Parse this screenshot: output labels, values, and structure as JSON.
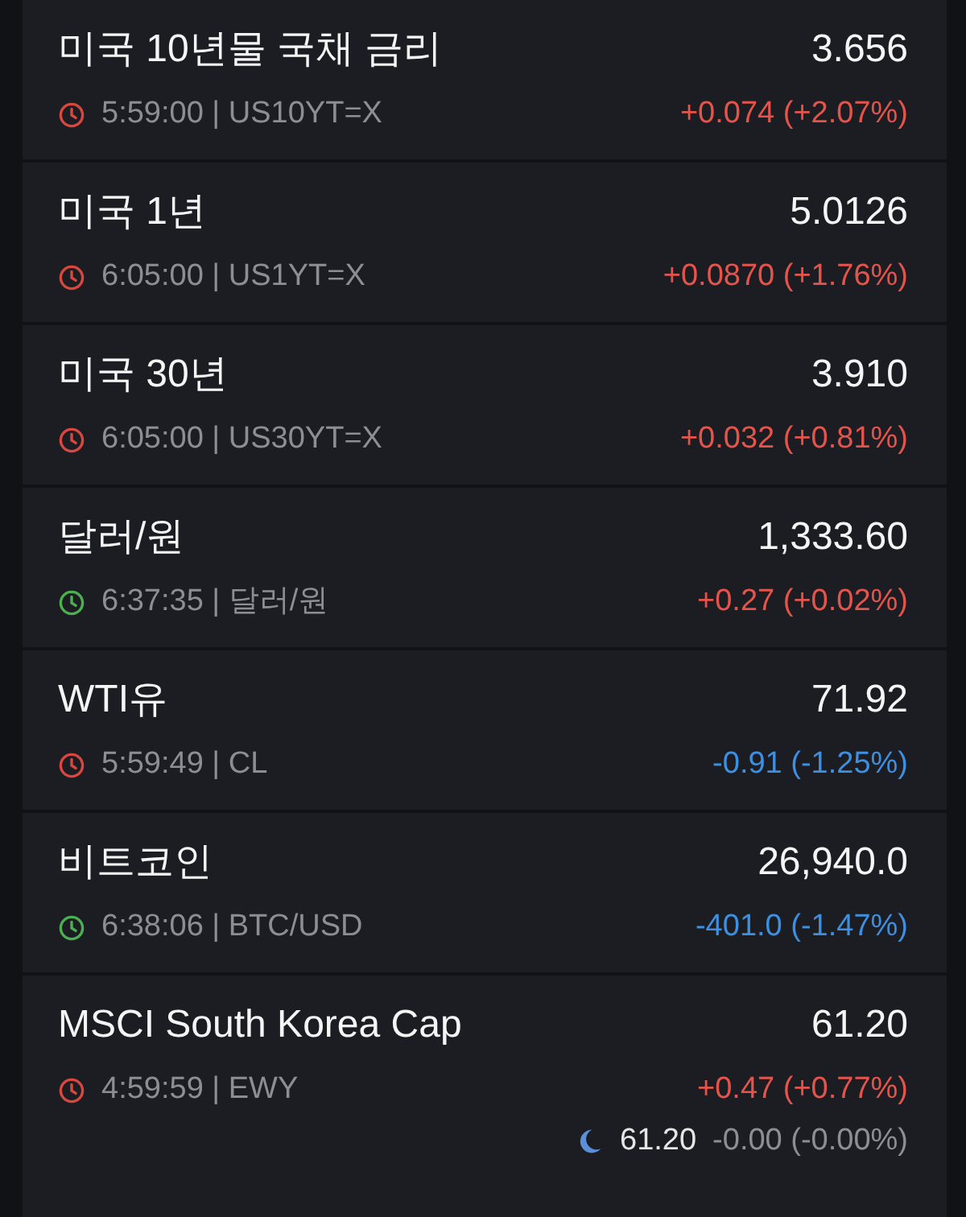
{
  "quotes": [
    {
      "name": "미국 10년물 국채 금리",
      "price": "3.656",
      "clock": {
        "color": "#d9483f"
      },
      "time_symbol": "5:59:00 | US10YT=X",
      "change": {
        "text": "+0.074 (+2.07%)",
        "color": "#e5544b"
      }
    },
    {
      "name": "미국 1년",
      "price": "5.0126",
      "clock": {
        "color": "#d9483f"
      },
      "time_symbol": "6:05:00 | US1YT=X",
      "change": {
        "text": "+0.0870 (+1.76%)",
        "color": "#e5544b"
      }
    },
    {
      "name": "미국 30년",
      "price": "3.910",
      "clock": {
        "color": "#d9483f"
      },
      "time_symbol": "6:05:00 | US30YT=X",
      "change": {
        "text": "+0.032 (+0.81%)",
        "color": "#e5544b"
      }
    },
    {
      "name": "달러/원",
      "price": "1,333.60",
      "clock": {
        "color": "#4caf50"
      },
      "time_symbol": "6:37:35 | 달러/원",
      "change": {
        "text": "+0.27 (+0.02%)",
        "color": "#e5544b"
      }
    },
    {
      "name": "WTI유",
      "price": "71.92",
      "clock": {
        "color": "#d9483f"
      },
      "time_symbol": "5:59:49 | CL",
      "change": {
        "text": "-0.91 (-1.25%)",
        "color": "#3d8fe0"
      }
    },
    {
      "name": "비트코인",
      "price": "26,940.0",
      "clock": {
        "color": "#4caf50"
      },
      "time_symbol": "6:38:06 | BTC/USD",
      "change": {
        "text": "-401.0 (-1.47%)",
        "color": "#3d8fe0"
      }
    },
    {
      "name": "MSCI South Korea Cap",
      "price": "61.20",
      "clock": {
        "color": "#d9483f"
      },
      "time_symbol": "4:59:59 | EWY",
      "change": {
        "text": "+0.47 (+0.77%)",
        "color": "#e5544b"
      },
      "after_hours": {
        "price": "61.20",
        "change": "-0.00 (-0.00%)"
      }
    }
  ]
}
